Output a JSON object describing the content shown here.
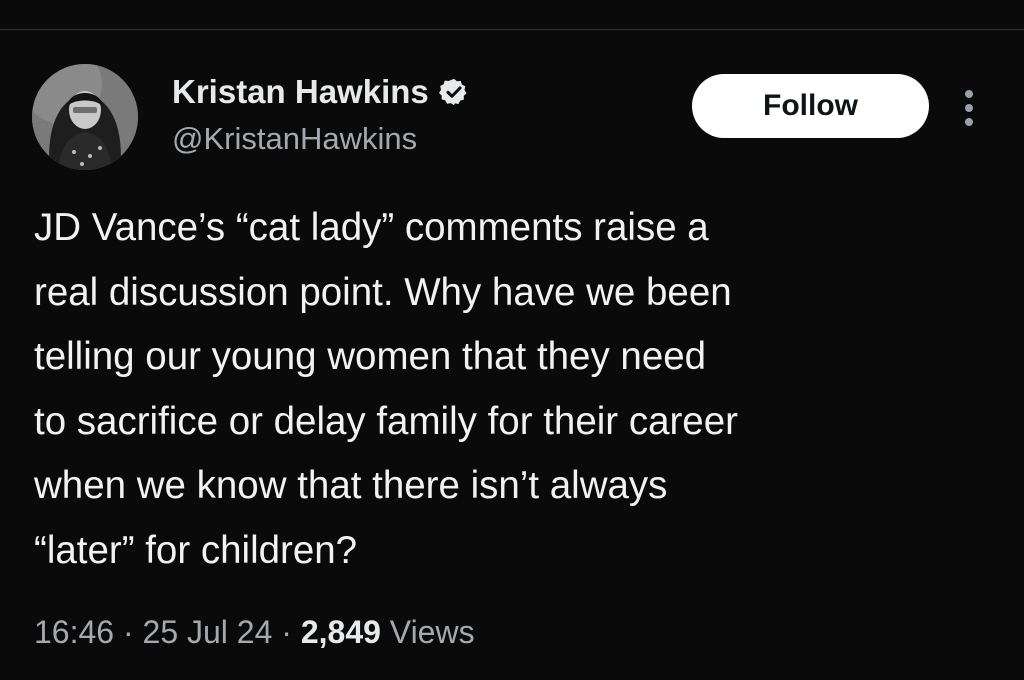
{
  "author": {
    "display_name": "Kristan Hawkins",
    "handle": "@KristanHawkins",
    "verified_icon": "verified-badge-icon",
    "avatar_icon": "profile-photo"
  },
  "actions": {
    "follow_label": "Follow",
    "more_icon": "more-vertical-icon"
  },
  "tweet": {
    "text": "JD Vance’s “cat lady” comments raise a\nreal discussion point. Why have we been\ntelling our young women that they need\nto sacrifice or delay family for their career\nwhen we know that there isn’t always\n“later” for children?"
  },
  "meta": {
    "time": "16:46",
    "separator": "·",
    "date": "25 Jul 24",
    "views_count": "2,849",
    "views_label": "Views"
  },
  "colors": {
    "background": "#0a0a0a",
    "text_primary": "#e7e9ea",
    "text_secondary": "#a5a9ad",
    "follow_button_bg": "#ffffff"
  }
}
